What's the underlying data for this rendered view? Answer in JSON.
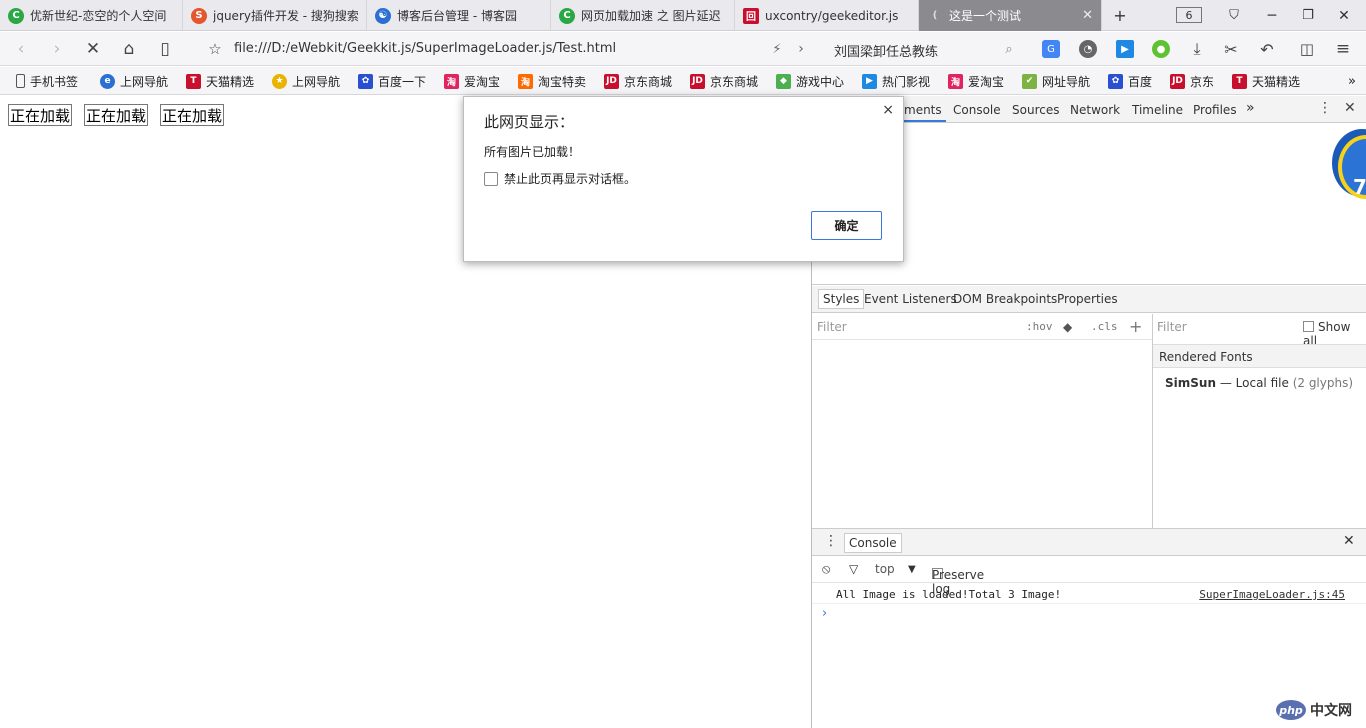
{
  "tabs": [
    {
      "title": "优新世纪-恋空的个人空间",
      "fav_color": "#2aa845",
      "fav_glyph": "C"
    },
    {
      "title": "jquery插件开发 - 搜狗搜索",
      "fav_color": "#e4572e",
      "fav_glyph": "S"
    },
    {
      "title": "博客后台管理 - 博客园",
      "fav_color": "#2a6fd1",
      "fav_glyph": "☯"
    },
    {
      "title": "网页加载加速 之 图片延迟",
      "fav_color": "#2aa845",
      "fav_glyph": "C"
    },
    {
      "title": "uxcontry/geekeditor.js",
      "fav_color": "#c8102e",
      "fav_glyph": "回"
    },
    {
      "title": "这是一个测试",
      "fav_color": "#bbbbbb",
      "fav_glyph": "("
    }
  ],
  "tabbar": {
    "new_tab": "+",
    "tab_count": "6"
  },
  "nav": {
    "url": "file:///D:/eWebkit/Geekkit.js/SuperImageLoader.js/Test.html",
    "search_text": "刘国梁卸任总教练"
  },
  "bookmarks": [
    {
      "label": "手机书签",
      "color": "#ffffff",
      "glyph": ""
    },
    {
      "label": "上网导航",
      "color": "#2a6fd1",
      "glyph": "e"
    },
    {
      "label": "天猫精选",
      "color": "#c8102e",
      "glyph": "T"
    },
    {
      "label": "上网导航",
      "color": "#e8b400",
      "glyph": "★"
    },
    {
      "label": "百度一下",
      "color": "#2a4fd1",
      "glyph": "✿"
    },
    {
      "label": "爱淘宝",
      "color": "#e0245e",
      "glyph": "淘"
    },
    {
      "label": "淘宝特卖",
      "color": "#ff6a00",
      "glyph": "淘"
    },
    {
      "label": "京东商城",
      "color": "#c8102e",
      "glyph": "JD"
    },
    {
      "label": "京东商城",
      "color": "#c8102e",
      "glyph": "JD"
    },
    {
      "label": "游戏中心",
      "color": "#4caf50",
      "glyph": "◆"
    },
    {
      "label": "热门影视",
      "color": "#1e88e5",
      "glyph": "▶"
    },
    {
      "label": "爱淘宝",
      "color": "#e0245e",
      "glyph": "淘"
    },
    {
      "label": "网址导航",
      "color": "#7cb342",
      "glyph": "✔"
    },
    {
      "label": "百度",
      "color": "#2a4fd1",
      "glyph": "✿"
    },
    {
      "label": "京东",
      "color": "#c8102e",
      "glyph": "JD"
    },
    {
      "label": "天猫精选",
      "color": "#c8102e",
      "glyph": "T"
    }
  ],
  "page": {
    "buttons": [
      "正在加载",
      "正在加载",
      "正在加载"
    ]
  },
  "devtools": {
    "tabs": [
      "ments",
      "Console",
      "Sources",
      "Network",
      "Timeline",
      "Profiles"
    ],
    "more": "»",
    "badge_number": "7",
    "styles_tabs": [
      "Styles",
      "Event Listeners",
      "DOM Breakpoints",
      "Properties"
    ],
    "filter_placeholder": "Filter",
    "hov": ":hov",
    "cls": ".cls",
    "computed_filter": "Filter",
    "show_all": "Show all",
    "rendered_fonts_header": "Rendered Fonts",
    "font_name": "SimSun",
    "font_dash": "—",
    "font_source": "Local file",
    "font_glyphs": "(2 glyphs)",
    "console_tab": "Console",
    "context": "top",
    "preserve_log": "Preserve log",
    "log_message": "All Image is loaded!Total 3 Image!",
    "log_source": "SuperImageLoader.js:45",
    "prompt": "›"
  },
  "dialog": {
    "title": "此网页显示：",
    "message": "所有图片已加载！",
    "checkbox_label": "禁止此页再显示对话框。",
    "ok_label": "确定",
    "close": "×"
  },
  "watermark": {
    "logo": "php",
    "text": "中文网"
  }
}
